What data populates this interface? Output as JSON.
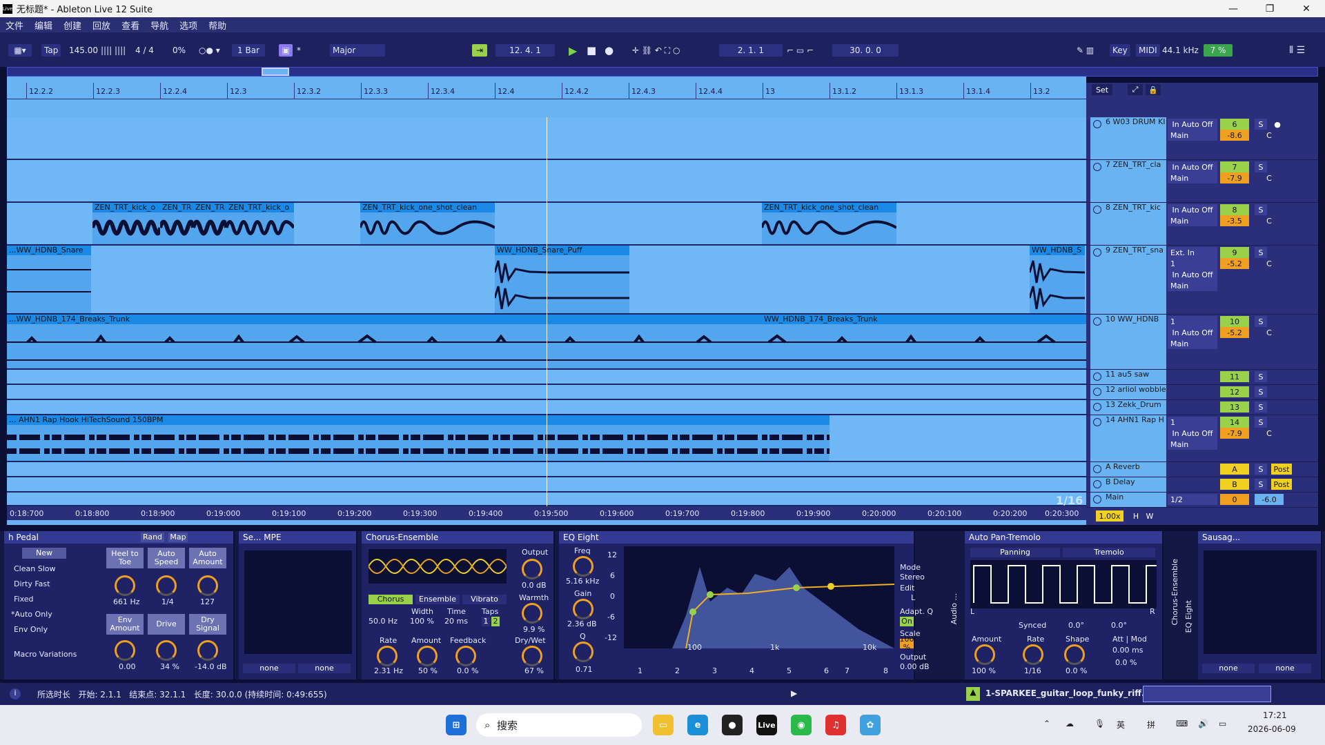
{
  "window": {
    "title": "无标题* - Ableton Live 12 Suite",
    "app_icon": "Live",
    "minimize": "—",
    "maximize": "❐",
    "close": "✕"
  },
  "menu": [
    "文件",
    "编辑",
    "创建",
    "回放",
    "查看",
    "导航",
    "选项",
    "帮助"
  ],
  "control": {
    "tap": "Tap",
    "tempo": "145.00",
    "time_sig": "4 / 4",
    "swing": "0%",
    "quantize": "1 Bar",
    "scale_root": "*",
    "scale": "Major",
    "arrange_pos": "12.  4.  1",
    "loop_start": "2.  1.  1",
    "loop_len": "30.  0.  0",
    "key": "Key",
    "midi": "MIDI",
    "sample_rate": "44.1 kHz",
    "cpu": "7 %"
  },
  "ruler": {
    "ticks": [
      "12.2.2",
      "12.2.3",
      "12.2.4",
      "12.3",
      "12.3.2",
      "12.3.3",
      "12.3.4",
      "12.4",
      "12.4.2",
      "12.4.3",
      "12.4.4",
      "13",
      "13.1.2",
      "13.1.3",
      "13.1.4",
      "13.2"
    ],
    "set": "Set"
  },
  "clips": {
    "kick1": "ZEN_TRT_kick_o",
    "kick2": "ZEN_TR",
    "kick3": "ZEN_TR",
    "kick4": "ZEN_TRT_kick_o",
    "kick5": "ZEN_TRT_kick_one_shot_clean",
    "kick6": "ZEN_TRT_kick_one_shot_clean",
    "snare1": "...WW_HDNB_Snare",
    "snare2": "WW_HDNB_Snare_Puff",
    "snare3": "WW_HDNB_S",
    "breaks1": "...WW_HDNB_174_Breaks_Trunk",
    "breaks2": "WW_HDNB_174_Breaks_Trunk",
    "vocal": "... AHN1 Rap Hook HiTechSound 150BPM"
  },
  "timebar": [
    "0:18:700",
    "0:18:800",
    "0:18:900",
    "0:19:000",
    "0:19:100",
    "0:19:200",
    "0:19:300",
    "0:19:400",
    "0:19:500",
    "0:19:600",
    "0:19:700",
    "0:19:800",
    "0:19:900",
    "0:20:000",
    "0:20:100",
    "0:20:200",
    "0:20:300"
  ],
  "grid_label": "1/16",
  "tracks": [
    {
      "name": "6 W03 DRUM KI",
      "num": "6",
      "input": "Main",
      "vol": "-8.6",
      "pan": "C"
    },
    {
      "name": "7 ZEN_TRT_cla",
      "num": "7",
      "input": "Main",
      "vol": "-7.9",
      "pan": "C"
    },
    {
      "name": "8 ZEN_TRT_kic",
      "num": "8",
      "input": "Main",
      "vol": "-3.5",
      "pan": "C"
    },
    {
      "name": "9 ZEN_TRT_sna",
      "num": "9",
      "input": "Ext. In",
      "ch": "1",
      "out": "Main",
      "vol": "-5.2",
      "pan": "C"
    },
    {
      "name": "10 WW_HDNB",
      "num": "10",
      "input": "1",
      "out": "Main",
      "vol": "-5.2",
      "pan": "C"
    },
    {
      "name": "11 au5 saw",
      "num": "11"
    },
    {
      "name": "12 arliol wobble",
      "num": "12"
    },
    {
      "name": "13 Zekk_Drum",
      "num": "13"
    },
    {
      "name": "14 AHN1 Rap H",
      "num": "14",
      "input": "1",
      "out": "Main",
      "vol": "-7.9",
      "pan": "C"
    },
    {
      "name": "A Reverb",
      "num": "A",
      "post": "Post"
    },
    {
      "name": "B Delay",
      "num": "B",
      "post": "Post"
    },
    {
      "name": "Main",
      "num": "0",
      "input": "1/2",
      "vol": "-6.0"
    }
  ],
  "mix_common": {
    "in": "In",
    "auto": "Auto",
    "off": "Off",
    "s": "S",
    "inf": "-∞"
  },
  "zoom": {
    "value": "1.00x",
    "h": "H",
    "w": "W"
  },
  "device1": {
    "title": "h Pedal",
    "rand": "Rand",
    "map": "Map",
    "new": "New",
    "presets": [
      "Clean Slow",
      "Dirty Fast",
      "Fixed",
      "*Auto Only",
      "Env Only"
    ],
    "macro_var": "Macro Variations",
    "b1": "Heel to Toe",
    "b2": "Auto Speed",
    "b3": "Auto Amount",
    "v1": "661 Hz",
    "v2": "1/4",
    "v3": "127",
    "b4": "Env Amount",
    "b5": "Drive",
    "b6": "Dry Signal",
    "v4": "0.00",
    "v5": "34 %",
    "v6": "-14.0 dB"
  },
  "device2": {
    "title": "Se... MPE",
    "none1": "none",
    "none2": "none"
  },
  "device3": {
    "title": "Chorus-Ensemble",
    "modes": [
      "Chorus",
      "Ensemble",
      "Vibrato"
    ],
    "output": "Output",
    "output_v": "0.0 dB",
    "warmth": "Warmth",
    "warmth_v": "9.9 %",
    "hz": "50.0 Hz",
    "width": "Width",
    "width_v": "100 %",
    "time": "Time",
    "time_v": "20 ms",
    "taps": "Taps",
    "tap1": "1",
    "tap2": "2",
    "rate": "Rate",
    "rate_v": "2.31 Hz",
    "amount": "Amount",
    "amount_v": "50 %",
    "feedback": "Feedback",
    "feedback_v": "0.0 %",
    "drywet": "Dry/Wet",
    "drywet_v": "67 %"
  },
  "device4": {
    "title": "EQ Eight",
    "freq": "Freq",
    "freq_v": "5.16 kHz",
    "gain": "Gain",
    "gain_v": "2.36 dB",
    "q": "Q",
    "q_v": "0.71",
    "db": [
      "12",
      "6",
      "0",
      "-6",
      "-12"
    ],
    "fx": [
      "100",
      "1k",
      "10k"
    ],
    "mode": "Mode",
    "mode_v": "Stereo",
    "edit": "Edit",
    "edit_v": "L",
    "adapt": "Adapt. Q",
    "adapt_v": "On",
    "scale": "Scale",
    "scale_v": "100 %",
    "output": "Output",
    "output_v": "0.00 dB",
    "bands": [
      "1",
      "2",
      "3",
      "4",
      "5",
      "6",
      "7",
      "8"
    ]
  },
  "device5": {
    "title": "Auto Pan-Tremolo",
    "tab1": "Panning",
    "tab2": "Tremolo",
    "synced": "Synced",
    "deg": "0.0°",
    "deg2": "0.0°",
    "amount": "Amount",
    "amount_v": "100 %",
    "rate": "Rate",
    "rate_v": "1/16",
    "shape": "Shape",
    "shape_v": "0.0 %",
    "att": "Att | Mod",
    "att_v": "0.00 ms",
    "mod_v": "0.0 %",
    "l": "L",
    "r": "R"
  },
  "device6": {
    "title": "Sausag...",
    "none1": "none",
    "none2": "none"
  },
  "vert_labels": {
    "audio": "Audio ...",
    "chorus": "Chorus-Ensemble",
    "eq": "EQ Eight"
  },
  "status": {
    "text": "所选时长   开始: 2.1.1   结束点: 32.1.1   长度: 30.0.0 (持续时间: 0:49:655)",
    "clip": "1-SPARKEE_guitar_loop_funky_riff..."
  },
  "taskbar": {
    "search": "搜索",
    "time": "17:21",
    "date": "2026-06-09",
    "ime1": "英",
    "ime2": "拼",
    "live": "Live"
  }
}
